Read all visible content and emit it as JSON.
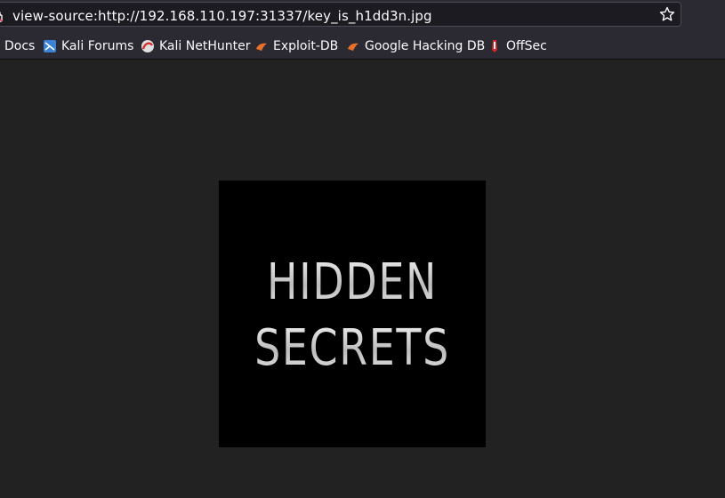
{
  "browser": {
    "url": "view-source:http://192.168.110.197:31337/key_is_h1dd3n.jpg",
    "bookmarks": [
      {
        "label": "Docs",
        "icon": "kali-docs-icon"
      },
      {
        "label": "Kali Forums",
        "icon": "kali-forums-icon"
      },
      {
        "label": "Kali NetHunter",
        "icon": "kali-nethunter-icon"
      },
      {
        "label": "Exploit-DB",
        "icon": "exploit-db-icon"
      },
      {
        "label": "Google Hacking DB",
        "icon": "exploit-db-icon"
      },
      {
        "label": "OffSec",
        "icon": "offsec-icon"
      }
    ]
  },
  "image": {
    "line1": "HIDDEN",
    "line2": "SECRETS"
  },
  "colors": {
    "toolbar_bg": "#2b2a33",
    "page_bg": "#222222",
    "image_bg": "#000000",
    "text": "#fbfbfe"
  }
}
